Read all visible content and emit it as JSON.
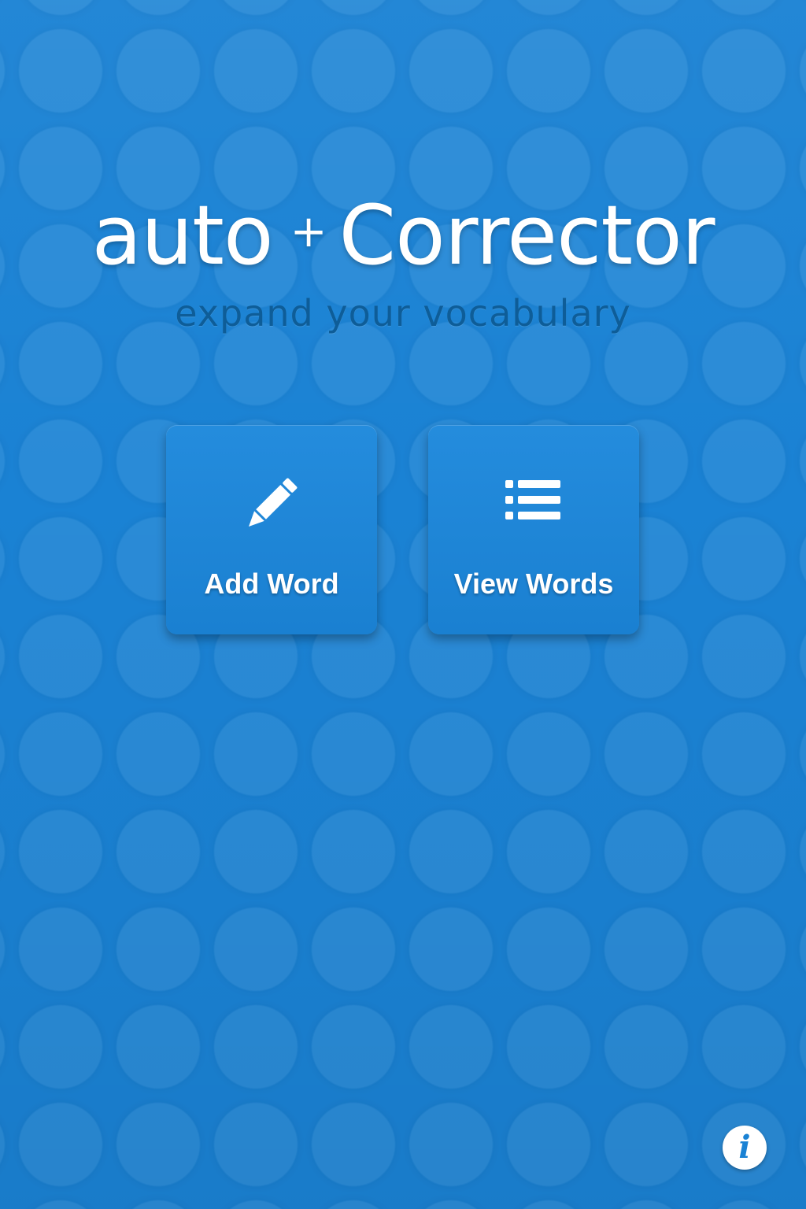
{
  "app": {
    "logo_left": "auto",
    "logo_separator": "+",
    "logo_right": "Corrector",
    "tagline": "expand your vocabulary"
  },
  "actions": [
    {
      "label": "Add Word",
      "icon": "pencil-icon"
    },
    {
      "label": "View Words",
      "icon": "list-icon"
    }
  ],
  "info_button": {
    "glyph": "i",
    "icon": "info-icon"
  },
  "colors": {
    "background": "#1a82d4",
    "tagline": "#0e5d98",
    "text": "#ffffff"
  }
}
